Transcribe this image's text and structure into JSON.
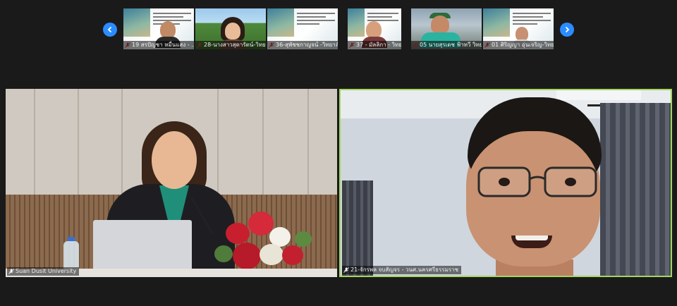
{
  "filmstrip": {
    "prev_label": "previous",
    "next_label": "next",
    "participants": [
      {
        "name": "19 สรปัญชา หมื่นแสง - ...",
        "type": "slide"
      },
      {
        "name": "28-นางสาวสุดารัตน์-วิทยา...",
        "type": "outdoor"
      },
      {
        "name": "36-สุพัชชกาญจน์ -วิทยาลั...",
        "type": "slide"
      },
      {
        "name": "37 - มัลลิกา - วิทยาลัยชุม...",
        "type": "slide"
      },
      {
        "name": "05 นายสุรเดช ฟ้าทวี วิทย...",
        "type": "mountain"
      },
      {
        "name": "01 ศิริญญา อุ่นเจริญ-วิทย...",
        "type": "slide"
      }
    ]
  },
  "main": {
    "left": {
      "name": "Suan Dusit University"
    },
    "right": {
      "name": "21-จักรพล จบสัญจร - วนศ.นครศรีธรรมราช"
    }
  },
  "colors": {
    "accent": "#2b8cff",
    "active_speaker_border": "#a4d65e",
    "background": "#1a1a1a"
  },
  "icons": {
    "prev": "chevron-left-icon",
    "next": "chevron-right-icon",
    "muted": "mic-muted-icon"
  }
}
